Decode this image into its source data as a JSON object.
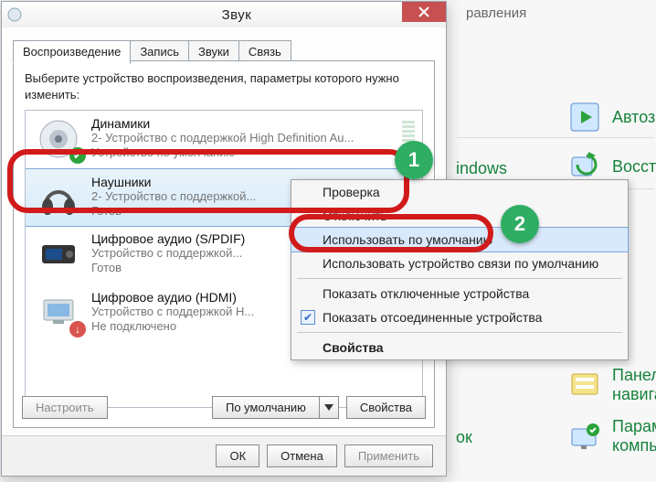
{
  "dialog": {
    "title": "Звук",
    "close_tooltip": "Закрыть",
    "tabs": [
      "Воспроизведение",
      "Запись",
      "Звуки",
      "Связь"
    ],
    "active_tab": 0,
    "instruction": "Выберите устройство воспроизведения, параметры которого нужно изменить:",
    "devices": [
      {
        "name": "Динамики",
        "sub1": "2- Устройство с поддержкой High Definition Au...",
        "sub2": "Устройство по умолчанию",
        "badge": "green"
      },
      {
        "name": "Наушники",
        "sub1": "2- Устройство с поддержкой...",
        "sub2": "Готов",
        "selected": true
      },
      {
        "name": "Цифровое аудио (S/PDIF)",
        "sub1": "Устройство с поддержкой...",
        "sub2": "Готов"
      },
      {
        "name": "Цифровое аудио (HDMI)",
        "sub1": "Устройство с поддержкой H...",
        "sub2": "Не подключено",
        "badge": "red"
      }
    ],
    "configure_btn": "Настроить",
    "default_btn": "По умолчанию",
    "properties_btn": "Свойства",
    "ok_btn": "ОК",
    "cancel_btn": "Отмена",
    "apply_btn": "Применить"
  },
  "context_menu": {
    "items": [
      {
        "label": "Проверка"
      },
      {
        "label": "Отключить"
      },
      {
        "label": "Использовать по умолчанию",
        "highlighted": true
      },
      {
        "label": "Использовать устройство связи по умолчанию"
      },
      {
        "sep": true
      },
      {
        "label": "Показать отключенные устройства"
      },
      {
        "label": "Показать отсоединенные устройства",
        "checked": true
      },
      {
        "sep": true
      },
      {
        "label": "Свойства",
        "bold": true
      }
    ]
  },
  "background": {
    "header_fragment": "равления",
    "items": [
      {
        "label": "Автоза"
      },
      {
        "label": "indows"
      },
      {
        "label": "Восста"
      },
      {
        "label": "ок"
      },
      {
        "label": "Панел\nнавига"
      },
      {
        "label": "Парам\nкомпь"
      }
    ]
  },
  "annotations": {
    "n1": "1",
    "n2": "2"
  }
}
